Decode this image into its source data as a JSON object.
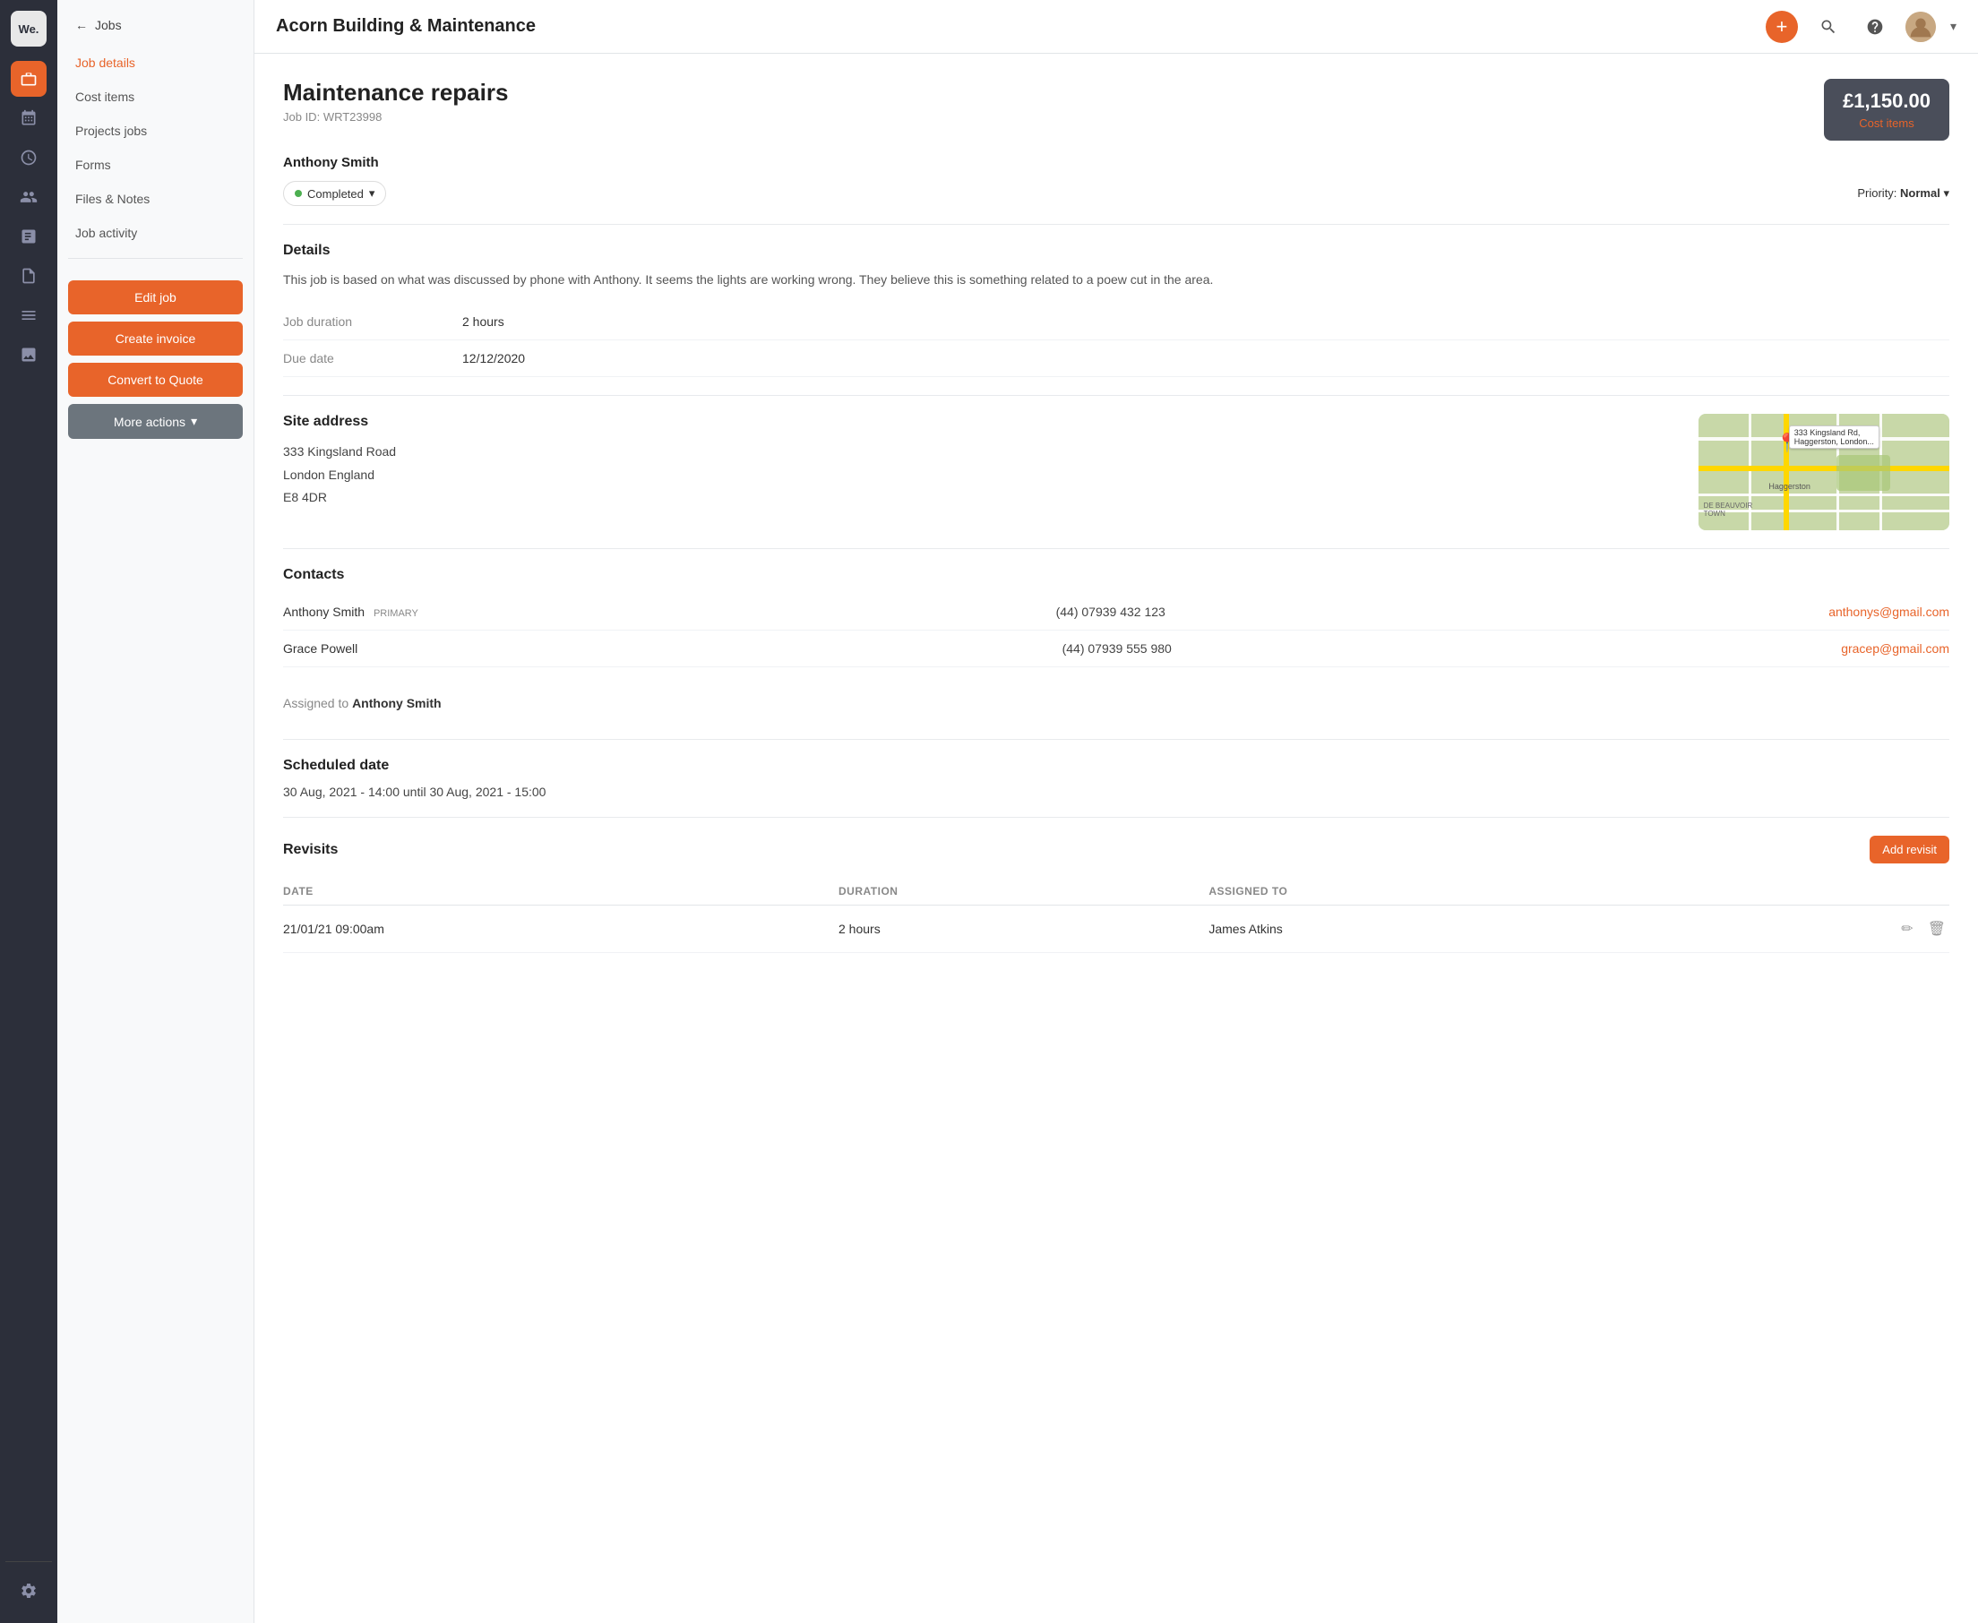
{
  "app": {
    "logo": "We.",
    "title": "Acorn Building & Maintenance"
  },
  "topbar": {
    "title": "Acorn Building & Maintenance",
    "add_tooltip": "Add new",
    "search_tooltip": "Search",
    "help_tooltip": "Help"
  },
  "sidebar": {
    "back_label": "Jobs",
    "nav_items": [
      {
        "id": "job-details",
        "label": "Job details",
        "active": true
      },
      {
        "id": "cost-items",
        "label": "Cost items",
        "active": false
      },
      {
        "id": "projects-jobs",
        "label": "Projects jobs",
        "active": false
      },
      {
        "id": "forms",
        "label": "Forms",
        "active": false
      },
      {
        "id": "files-notes",
        "label": "Files & Notes",
        "active": false
      },
      {
        "id": "job-activity",
        "label": "Job activity",
        "active": false
      }
    ],
    "buttons": {
      "edit_job": "Edit job",
      "create_invoice": "Create invoice",
      "convert_to_quote": "Convert to Quote",
      "more_actions": "More actions"
    }
  },
  "job": {
    "title": "Maintenance repairs",
    "job_id_label": "Job ID:",
    "job_id": "WRT23998",
    "cost_amount": "£1,150.00",
    "cost_items_link": "Cost items",
    "client_name": "Anthony Smith",
    "status": "Completed",
    "priority_label": "Priority:",
    "priority_value": "Normal",
    "details_title": "Details",
    "description": "This job is based on what was discussed by phone with Anthony. It seems the lights are working wrong. They believe this is something related to a poew cut in the area.",
    "job_duration_label": "Job duration",
    "job_duration": "2 hours",
    "due_date_label": "Due date",
    "due_date": "12/12/2020",
    "site_address_title": "Site address",
    "address_line1": "333 Kingsland Road",
    "address_line2": "London England",
    "address_line3": "E8 4DR",
    "map_label": "333 Kingsland Rd, Haggerston, London...",
    "contacts_title": "Contacts",
    "contacts": [
      {
        "name": "Anthony Smith",
        "primary": "PRIMARY",
        "phone": "(44) 07939 432 123",
        "email": "anthonys@gmail.com"
      },
      {
        "name": "Grace Powell",
        "primary": "",
        "phone": "(44) 07939 555 980",
        "email": "gracep@gmail.com"
      }
    ],
    "assigned_label": "Assigned to",
    "assigned_to": "Anthony Smith",
    "scheduled_title": "Scheduled date",
    "scheduled_date": "30 Aug, 2021 - 14:00 until 30 Aug, 2021 - 15:00",
    "revisits_title": "Revisits",
    "add_revisit_btn": "Add revisit",
    "revisits_headers": {
      "date": "DATE",
      "duration": "DURATION",
      "assigned_to": "ASSIGNED TO"
    },
    "revisits": [
      {
        "date": "21/01/21 09:00am",
        "duration": "2 hours",
        "assigned_to": "James Atkins"
      }
    ]
  },
  "icons": {
    "logo": "We.",
    "briefcase": "💼",
    "calendar": "📅",
    "clock": "🕐",
    "users": "👥",
    "chart": "📊",
    "document": "📄",
    "list": "☰",
    "image": "🖼",
    "gear": "⚙",
    "plus": "+",
    "search": "🔍",
    "help": "?",
    "back_arrow": "←",
    "chevron_down": "▾",
    "edit": "✏",
    "trash": "🗑",
    "map_pin": "📍"
  }
}
